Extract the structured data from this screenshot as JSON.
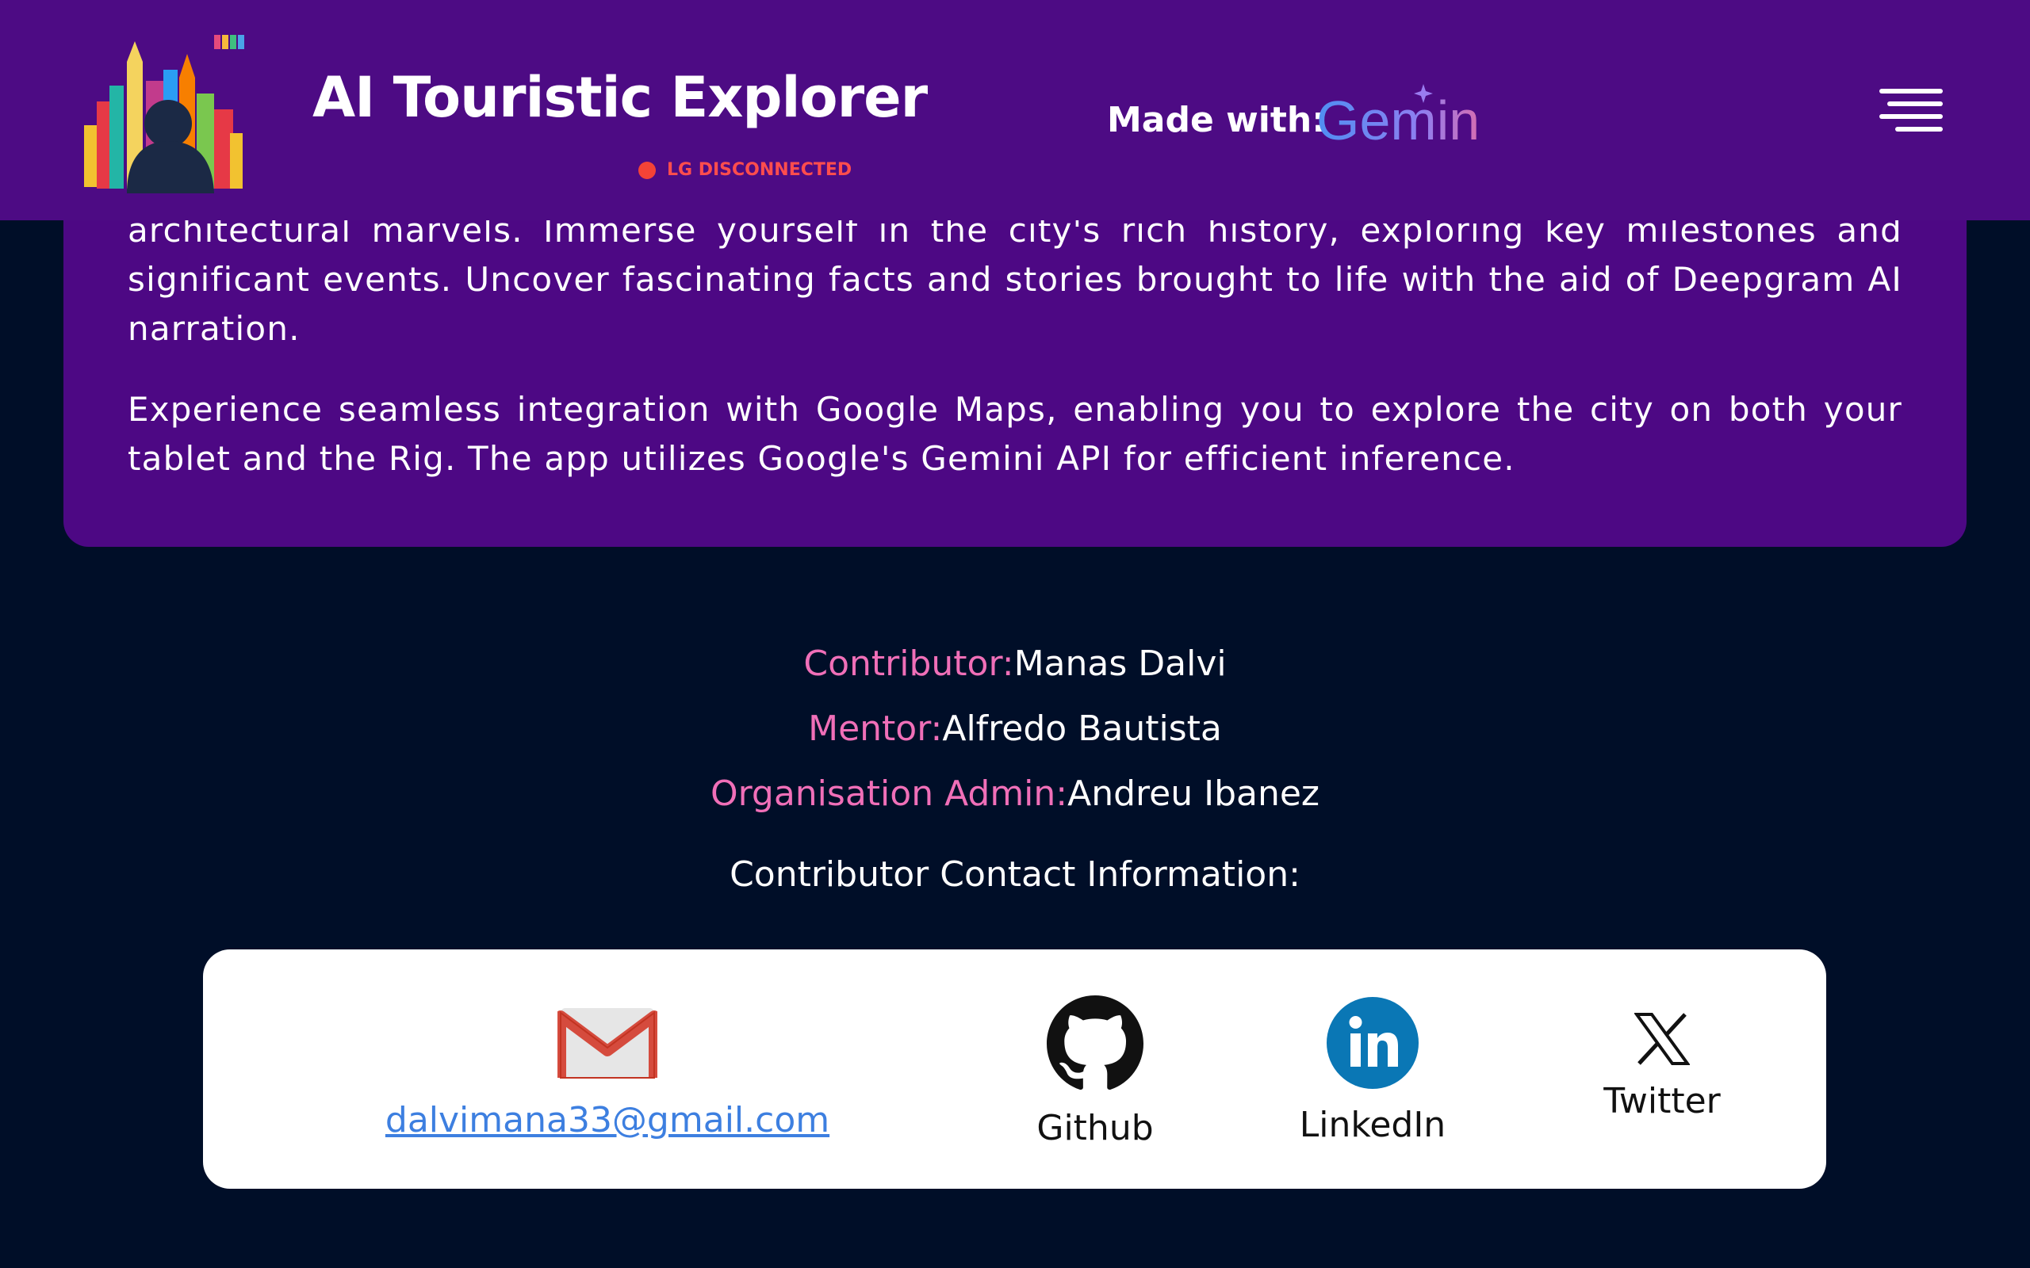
{
  "header": {
    "title": "AI Touristic Explorer",
    "lg_status": "LG DISCONNECTED",
    "made_with_label": "Made with:",
    "gemini_logo_text": "Gemini",
    "status_color": "#f44336",
    "background_color": "#4d0b84"
  },
  "about": {
    "paragraph_1": "architectural marvels. Immerse yourself in the city's rich history, exploring key milestones and significant events. Uncover fascinating facts and stories brought to life with the aid of Deepgram AI narration.",
    "paragraph_2": "Experience seamless integration with Google Maps, enabling you to explore the city on both your tablet and the Rig. The app utilizes Google's Gemini API for efficient inference."
  },
  "credits": {
    "contributor_label": "Contributor:",
    "contributor_name": "Manas Dalvi",
    "mentor_label": "Mentor:",
    "mentor_name": "Alfredo Bautista",
    "admin_label": "Organisation Admin:",
    "admin_name": "Andreu Ibanez",
    "label_color": "#f06fb8"
  },
  "contact": {
    "heading": "Contributor Contact Information:",
    "email": "dalvimana33@gmail.com",
    "github_label": "Github",
    "linkedin_label": "LinkedIn",
    "twitter_label": "Twitter",
    "icons": [
      "gmail-icon",
      "github-icon",
      "linkedin-icon",
      "x-twitter-icon"
    ]
  }
}
